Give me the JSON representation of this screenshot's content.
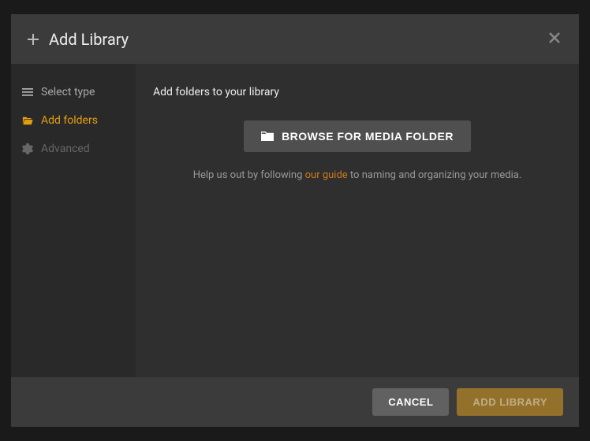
{
  "header": {
    "title": "Add Library"
  },
  "sidebar": {
    "items": [
      {
        "label": "Select type",
        "state": "inactive"
      },
      {
        "label": "Add folders",
        "state": "active"
      },
      {
        "label": "Advanced",
        "state": "disabled"
      }
    ]
  },
  "main": {
    "heading": "Add folders to your library",
    "browse_button_label": "BROWSE FOR MEDIA FOLDER",
    "help_prefix": "Help us out by following ",
    "help_link_text": "our guide",
    "help_suffix": " to naming and organizing your media."
  },
  "footer": {
    "cancel_label": "CANCEL",
    "primary_label": "ADD LIBRARY"
  }
}
